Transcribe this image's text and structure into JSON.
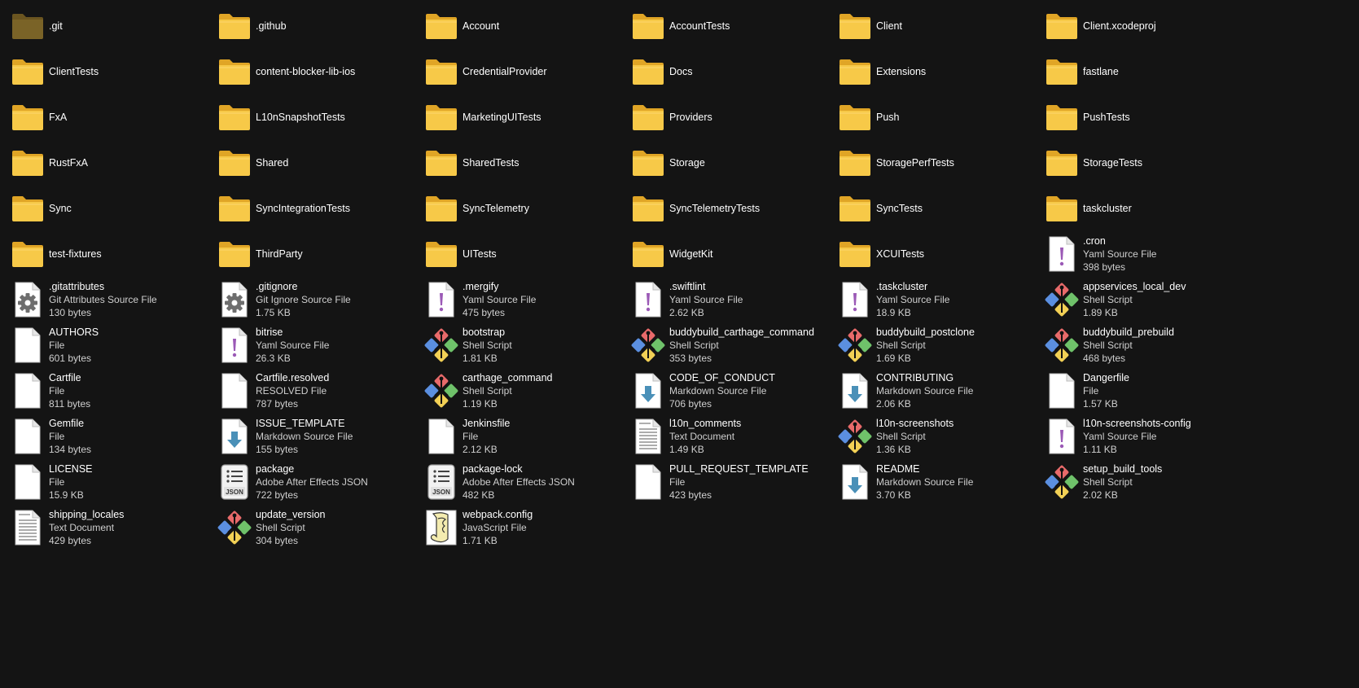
{
  "explorer": {
    "items": [
      {
        "name": ".git",
        "kind": "folder",
        "icon": "folder-icon",
        "hidden": true
      },
      {
        "name": ".github",
        "kind": "folder",
        "icon": "folder-icon"
      },
      {
        "name": "Account",
        "kind": "folder",
        "icon": "folder-icon"
      },
      {
        "name": "AccountTests",
        "kind": "folder",
        "icon": "folder-icon"
      },
      {
        "name": "Client",
        "kind": "folder",
        "icon": "folder-icon"
      },
      {
        "name": "Client.xcodeproj",
        "kind": "folder",
        "icon": "folder-icon"
      },
      {
        "name": "ClientTests",
        "kind": "folder",
        "icon": "folder-icon"
      },
      {
        "name": "content-blocker-lib-ios",
        "kind": "folder",
        "icon": "folder-icon"
      },
      {
        "name": "CredentialProvider",
        "kind": "folder",
        "icon": "folder-icon"
      },
      {
        "name": "Docs",
        "kind": "folder",
        "icon": "folder-icon"
      },
      {
        "name": "Extensions",
        "kind": "folder",
        "icon": "folder-icon"
      },
      {
        "name": "fastlane",
        "kind": "folder",
        "icon": "folder-icon"
      },
      {
        "name": "FxA",
        "kind": "folder",
        "icon": "folder-icon"
      },
      {
        "name": "L10nSnapshotTests",
        "kind": "folder",
        "icon": "folder-icon"
      },
      {
        "name": "MarketingUITests",
        "kind": "folder",
        "icon": "folder-icon"
      },
      {
        "name": "Providers",
        "kind": "folder",
        "icon": "folder-icon"
      },
      {
        "name": "Push",
        "kind": "folder",
        "icon": "folder-icon"
      },
      {
        "name": "PushTests",
        "kind": "folder",
        "icon": "folder-icon"
      },
      {
        "name": "RustFxA",
        "kind": "folder",
        "icon": "folder-icon"
      },
      {
        "name": "Shared",
        "kind": "folder",
        "icon": "folder-icon"
      },
      {
        "name": "SharedTests",
        "kind": "folder",
        "icon": "folder-icon"
      },
      {
        "name": "Storage",
        "kind": "folder",
        "icon": "folder-icon"
      },
      {
        "name": "StoragePerfTests",
        "kind": "folder",
        "icon": "folder-icon"
      },
      {
        "name": "StorageTests",
        "kind": "folder",
        "icon": "folder-icon"
      },
      {
        "name": "Sync",
        "kind": "folder",
        "icon": "folder-icon"
      },
      {
        "name": "SyncIntegrationTests",
        "kind": "folder",
        "icon": "folder-icon"
      },
      {
        "name": "SyncTelemetry",
        "kind": "folder",
        "icon": "folder-icon"
      },
      {
        "name": "SyncTelemetryTests",
        "kind": "folder",
        "icon": "folder-icon"
      },
      {
        "name": "SyncTests",
        "kind": "folder",
        "icon": "folder-icon"
      },
      {
        "name": "taskcluster",
        "kind": "folder",
        "icon": "folder-icon"
      },
      {
        "name": "test-fixtures",
        "kind": "folder",
        "icon": "folder-icon"
      },
      {
        "name": "ThirdParty",
        "kind": "folder",
        "icon": "folder-icon"
      },
      {
        "name": "UITests",
        "kind": "folder",
        "icon": "folder-icon"
      },
      {
        "name": "WidgetKit",
        "kind": "folder",
        "icon": "folder-icon"
      },
      {
        "name": "XCUITests",
        "kind": "folder",
        "icon": "folder-icon"
      },
      {
        "name": ".cron",
        "kind": "file",
        "icon": "yaml-file-icon",
        "type": "Yaml Source File",
        "size": "398 bytes"
      },
      {
        "name": ".gitattributes",
        "kind": "file",
        "icon": "gear-file-icon",
        "type": "Git Attributes Source File",
        "size": "130 bytes"
      },
      {
        "name": ".gitignore",
        "kind": "file",
        "icon": "gear-file-icon",
        "type": "Git Ignore Source File",
        "size": "1.75 KB"
      },
      {
        "name": ".mergify",
        "kind": "file",
        "icon": "yaml-file-icon",
        "type": "Yaml Source File",
        "size": "475 bytes"
      },
      {
        "name": ".swiftlint",
        "kind": "file",
        "icon": "yaml-file-icon",
        "type": "Yaml Source File",
        "size": "2.62 KB"
      },
      {
        "name": ".taskcluster",
        "kind": "file",
        "icon": "yaml-file-icon",
        "type": "Yaml Source File",
        "size": "18.9 KB"
      },
      {
        "name": "appservices_local_dev",
        "kind": "file",
        "icon": "shell-script-icon",
        "type": "Shell Script",
        "size": "1.89 KB"
      },
      {
        "name": "AUTHORS",
        "kind": "file",
        "icon": "blank-file-icon",
        "type": "File",
        "size": "601 bytes"
      },
      {
        "name": "bitrise",
        "kind": "file",
        "icon": "yaml-file-icon",
        "type": "Yaml Source File",
        "size": "26.3 KB"
      },
      {
        "name": "bootstrap",
        "kind": "file",
        "icon": "shell-script-icon",
        "type": "Shell Script",
        "size": "1.81 KB"
      },
      {
        "name": "buddybuild_carthage_command",
        "kind": "file",
        "icon": "shell-script-icon",
        "type": "Shell Script",
        "size": "353 bytes"
      },
      {
        "name": "buddybuild_postclone",
        "kind": "file",
        "icon": "shell-script-icon",
        "type": "Shell Script",
        "size": "1.69 KB"
      },
      {
        "name": "buddybuild_prebuild",
        "kind": "file",
        "icon": "shell-script-icon",
        "type": "Shell Script",
        "size": "468 bytes"
      },
      {
        "name": "Cartfile",
        "kind": "file",
        "icon": "blank-file-icon",
        "type": "File",
        "size": "811 bytes"
      },
      {
        "name": "Cartfile.resolved",
        "kind": "file",
        "icon": "blank-file-icon",
        "type": "RESOLVED File",
        "size": "787 bytes"
      },
      {
        "name": "carthage_command",
        "kind": "file",
        "icon": "shell-script-icon",
        "type": "Shell Script",
        "size": "1.19 KB"
      },
      {
        "name": "CODE_OF_CONDUCT",
        "kind": "file",
        "icon": "markdown-file-icon",
        "type": "Markdown Source File",
        "size": "706 bytes"
      },
      {
        "name": "CONTRIBUTING",
        "kind": "file",
        "icon": "markdown-file-icon",
        "type": "Markdown Source File",
        "size": "2.06 KB"
      },
      {
        "name": "Dangerfile",
        "kind": "file",
        "icon": "blank-file-icon",
        "type": "File",
        "size": "1.57 KB"
      },
      {
        "name": "Gemfile",
        "kind": "file",
        "icon": "blank-file-icon",
        "type": "File",
        "size": "134 bytes"
      },
      {
        "name": "ISSUE_TEMPLATE",
        "kind": "file",
        "icon": "markdown-file-icon",
        "type": "Markdown Source File",
        "size": "155 bytes"
      },
      {
        "name": "Jenkinsfile",
        "kind": "file",
        "icon": "blank-file-icon",
        "type": "File",
        "size": "2.12 KB"
      },
      {
        "name": "l10n_comments",
        "kind": "file",
        "icon": "text-document-icon",
        "type": "Text Document",
        "size": "1.49 KB"
      },
      {
        "name": "l10n-screenshots",
        "kind": "file",
        "icon": "shell-script-icon",
        "type": "Shell Script",
        "size": "1.36 KB"
      },
      {
        "name": "l10n-screenshots-config",
        "kind": "file",
        "icon": "yaml-file-icon",
        "type": "Yaml Source File",
        "size": "1.11 KB"
      },
      {
        "name": "LICENSE",
        "kind": "file",
        "icon": "blank-file-icon",
        "type": "File",
        "size": "15.9 KB"
      },
      {
        "name": "package",
        "kind": "file",
        "icon": "json-file-icon",
        "type": "Adobe After Effects JSON",
        "size": "722 bytes"
      },
      {
        "name": "package-lock",
        "kind": "file",
        "icon": "json-file-icon",
        "type": "Adobe After Effects JSON",
        "size": "482 KB"
      },
      {
        "name": "PULL_REQUEST_TEMPLATE",
        "kind": "file",
        "icon": "blank-file-icon",
        "type": "File",
        "size": "423 bytes"
      },
      {
        "name": "README",
        "kind": "file",
        "icon": "markdown-file-icon",
        "type": "Markdown Source File",
        "size": "3.70 KB"
      },
      {
        "name": "setup_build_tools",
        "kind": "file",
        "icon": "shell-script-icon",
        "type": "Shell Script",
        "size": "2.02 KB"
      },
      {
        "name": "shipping_locales",
        "kind": "file",
        "icon": "text-document-icon",
        "type": "Text Document",
        "size": "429 bytes"
      },
      {
        "name": "update_version",
        "kind": "file",
        "icon": "shell-script-icon",
        "type": "Shell Script",
        "size": "304 bytes"
      },
      {
        "name": "webpack.config",
        "kind": "file",
        "icon": "javascript-file-icon",
        "type": "JavaScript File",
        "size": "1.71 KB"
      }
    ]
  }
}
